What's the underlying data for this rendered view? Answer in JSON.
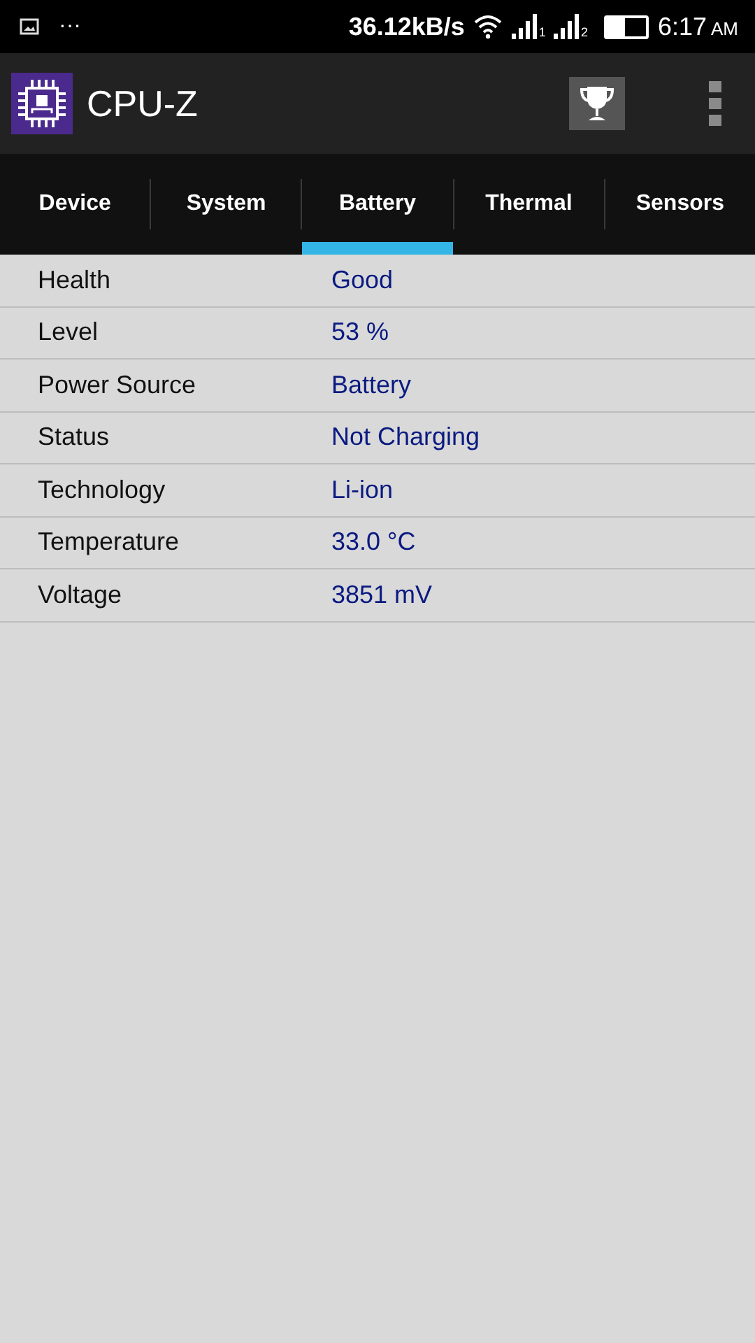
{
  "status_bar": {
    "notification_dots": "···",
    "speed": "36.12kB/s",
    "sims": [
      "1",
      "2"
    ],
    "time": "6:17",
    "ampm": "AM"
  },
  "app_bar": {
    "title": "CPU-Z"
  },
  "tabs": [
    {
      "label": "Device",
      "selected": false
    },
    {
      "label": "System",
      "selected": false
    },
    {
      "label": "Battery",
      "selected": true
    },
    {
      "label": "Thermal",
      "selected": false
    },
    {
      "label": "Sensors",
      "selected": false
    }
  ],
  "rows": [
    {
      "label": "Health",
      "value": "Good"
    },
    {
      "label": "Level",
      "value": "53 %"
    },
    {
      "label": "Power Source",
      "value": "Battery"
    },
    {
      "label": "Status",
      "value": "Not Charging"
    },
    {
      "label": "Technology",
      "value": "Li-ion"
    },
    {
      "label": "Temperature",
      "value": "33.0 °C"
    },
    {
      "label": "Voltage",
      "value": "3851 mV"
    }
  ]
}
